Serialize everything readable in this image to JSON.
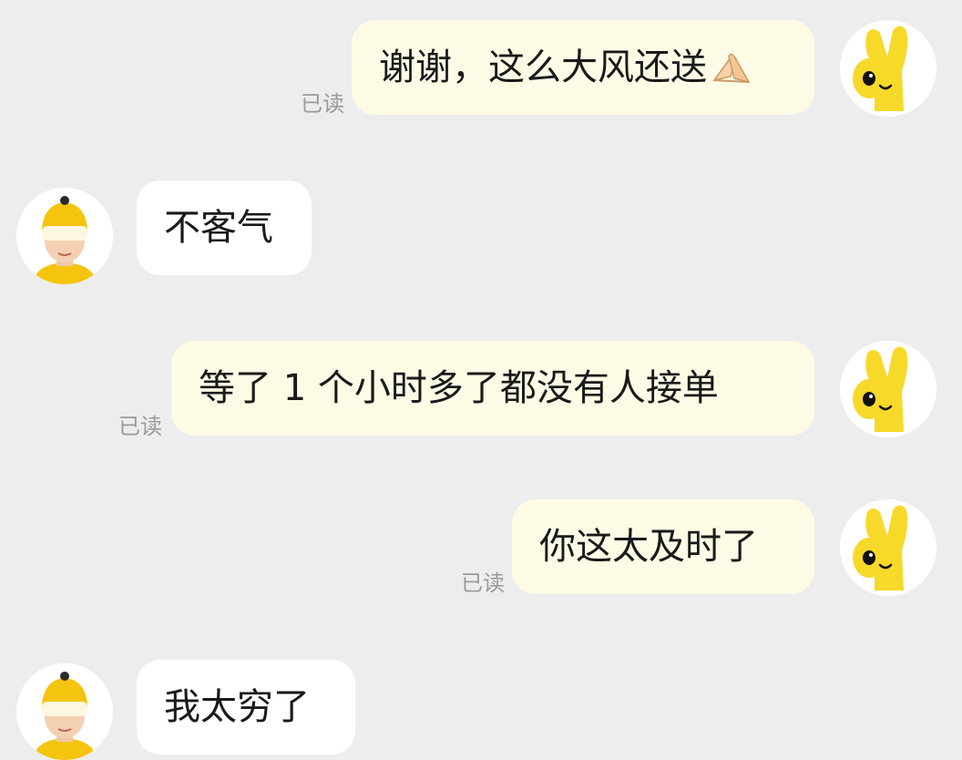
{
  "messages": [
    {
      "id": "m1",
      "side": "sent",
      "text": "谢谢，这么大风还送",
      "emoji": "pressed-hands-emoji",
      "read_status": "已读"
    },
    {
      "id": "m2",
      "side": "received",
      "text": "不客气"
    },
    {
      "id": "m3",
      "side": "sent",
      "text": "等了 1 个小时多了都没有人接单",
      "read_status": "已读"
    },
    {
      "id": "m4",
      "side": "sent",
      "text": "你这太及时了",
      "read_status": "已读"
    },
    {
      "id": "m5",
      "side": "received",
      "text": "我太穷了"
    }
  ],
  "avatars": {
    "self_icon": "yellow-peace-hand-mascot-icon",
    "other_icon": "courier-yellow-helmet-icon"
  },
  "colors": {
    "background": "#ededed",
    "sent_bubble": "#fdfbe6",
    "received_bubble": "#ffffff",
    "mascot_yellow": "#f7d92a",
    "helmet_yellow": "#f5c40f",
    "read_text": "#9a9a9a"
  }
}
